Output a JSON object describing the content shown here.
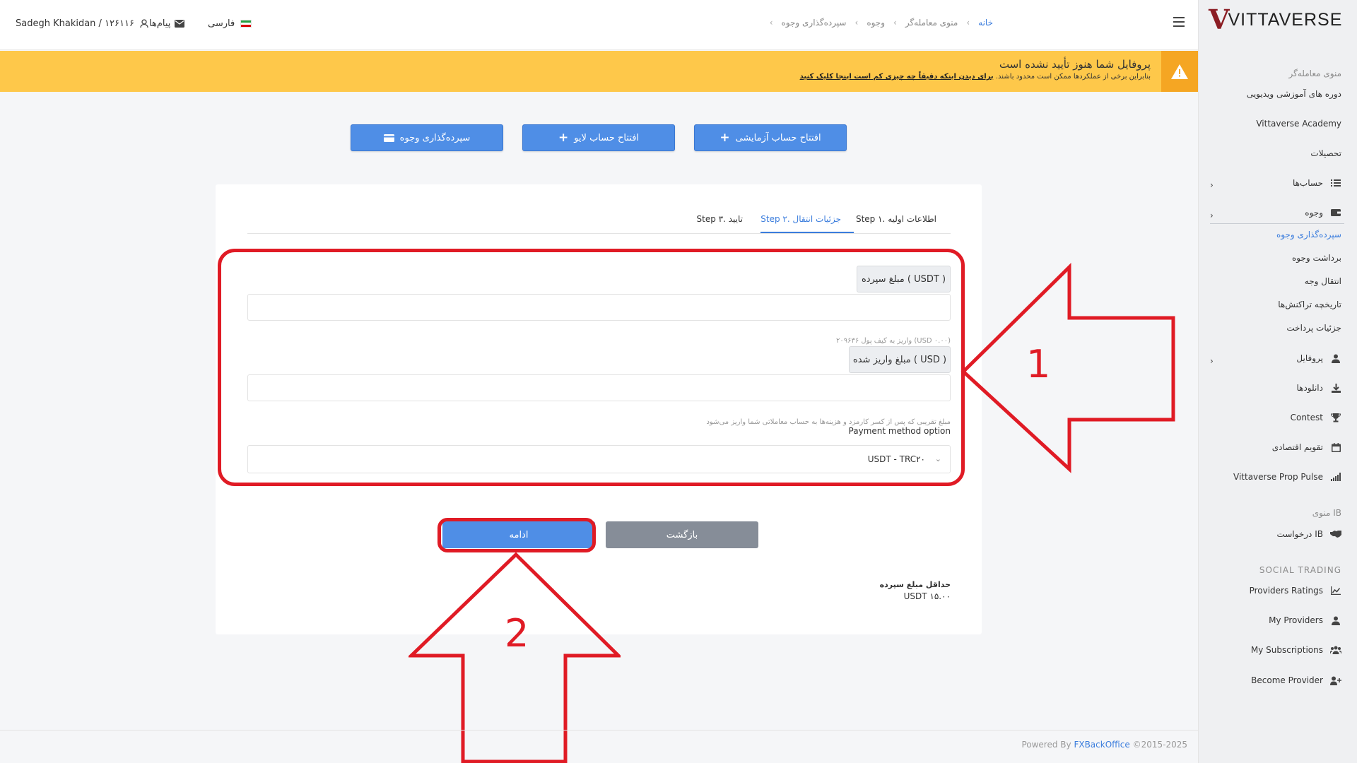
{
  "topbar": {
    "user": "Sadegh Khakidan / ۱۲۶۱۱۶",
    "messages": "پیام‌ها",
    "language": "فارسی",
    "breadcrumb": [
      "خانه",
      "منوی معامله‌گر",
      "وجوه",
      "سپرده‌گذاری وجوه"
    ]
  },
  "brand": {
    "logo_mark": "V",
    "logo_text": "VITTAVERSE"
  },
  "sidebar": {
    "trader_menu_title": "منوی معامله‌گر",
    "items": [
      {
        "label": "دوره های آموزشی ویدیویی"
      },
      {
        "label": "Vittaverse Academy"
      },
      {
        "label": "تحصیلات"
      },
      {
        "label": "حساب‌ها",
        "icon": "list-icon"
      },
      {
        "label": "وجوه",
        "icon": "wallet-icon"
      },
      {
        "label": "سپرده‌گذاری وجوه"
      },
      {
        "label": "برداشت وجوه"
      },
      {
        "label": "انتقال وجه"
      },
      {
        "label": "تاریخچه تراکنش‌ها"
      },
      {
        "label": "جزئیات پرداخت"
      },
      {
        "label": "پروفایل",
        "icon": "user-icon"
      },
      {
        "label": "دانلودها",
        "icon": "download-icon"
      },
      {
        "label": "Contest",
        "icon": "trophy-icon"
      },
      {
        "label": "تقویم اقتصادی",
        "icon": "calendar-icon"
      },
      {
        "label": "Vittaverse Prop Pulse",
        "icon": "signal-icon"
      }
    ],
    "ib_menu_title": "منوی IB",
    "ib_items": [
      {
        "label": "درخواست IB",
        "icon": "handshake-icon"
      }
    ],
    "social_title": "SOCIAL TRADING",
    "social_items": [
      {
        "label": "Providers Ratings",
        "icon": "chart-icon"
      },
      {
        "label": "My Providers",
        "icon": "user-icon"
      },
      {
        "label": "My Subscriptions",
        "icon": "users-icon"
      },
      {
        "label": "Become Provider",
        "icon": "user-plus-icon"
      }
    ]
  },
  "banner": {
    "title": "پروفایل شما هنوز تأیید نشده است",
    "desc_prefix": "بنابراین برخی از عملکردها ممکن است محدود باشند.",
    "desc_link": "برای دیدن اینکه دقیقاً چه چیزی کم است اینجا کلیک کنید"
  },
  "actions": {
    "demo": "افتتاح حساب آزمایشی",
    "live": "افتتاح حساب لایو",
    "deposit": "سپرده‌گذاری وجوه"
  },
  "tabs": [
    {
      "label": "Step ۱. اطلاعات اولیه"
    },
    {
      "label": "Step ۲. جزئیات انتقال"
    },
    {
      "label": "Step ۳. تایید"
    }
  ],
  "form": {
    "deposit_amount_label": "مبلغ سپرده ( USDT )",
    "wallet_hint": "واریز به کیف پول ۲۰۹۶۳۶ (USD ۰.۰۰)",
    "deposited_amount_label": "مبلغ واریز شده ( USD )",
    "deposited_hint": "مبلغ تقریبی که پس از کسر کارمزد و هزینه‌ها به حساب معاملاتی شما واریز می‌شود",
    "payment_method_label": "Payment method option",
    "payment_method_value": "USDT - TRC۲۰",
    "continue": "ادامه",
    "back": "بازگشت",
    "min_label": "حداقل مبلغ سپرده",
    "min_value": "USDT ۱۵.۰۰"
  },
  "annotations": {
    "one": "1",
    "two": "2"
  },
  "footer": {
    "powered": "Powered By",
    "brand": "FXBackOffice",
    "copyright": "©2015-2025"
  },
  "colors": {
    "accent": "#4f8ee6",
    "warning": "#fec84a",
    "annotation": "#e01b25"
  }
}
